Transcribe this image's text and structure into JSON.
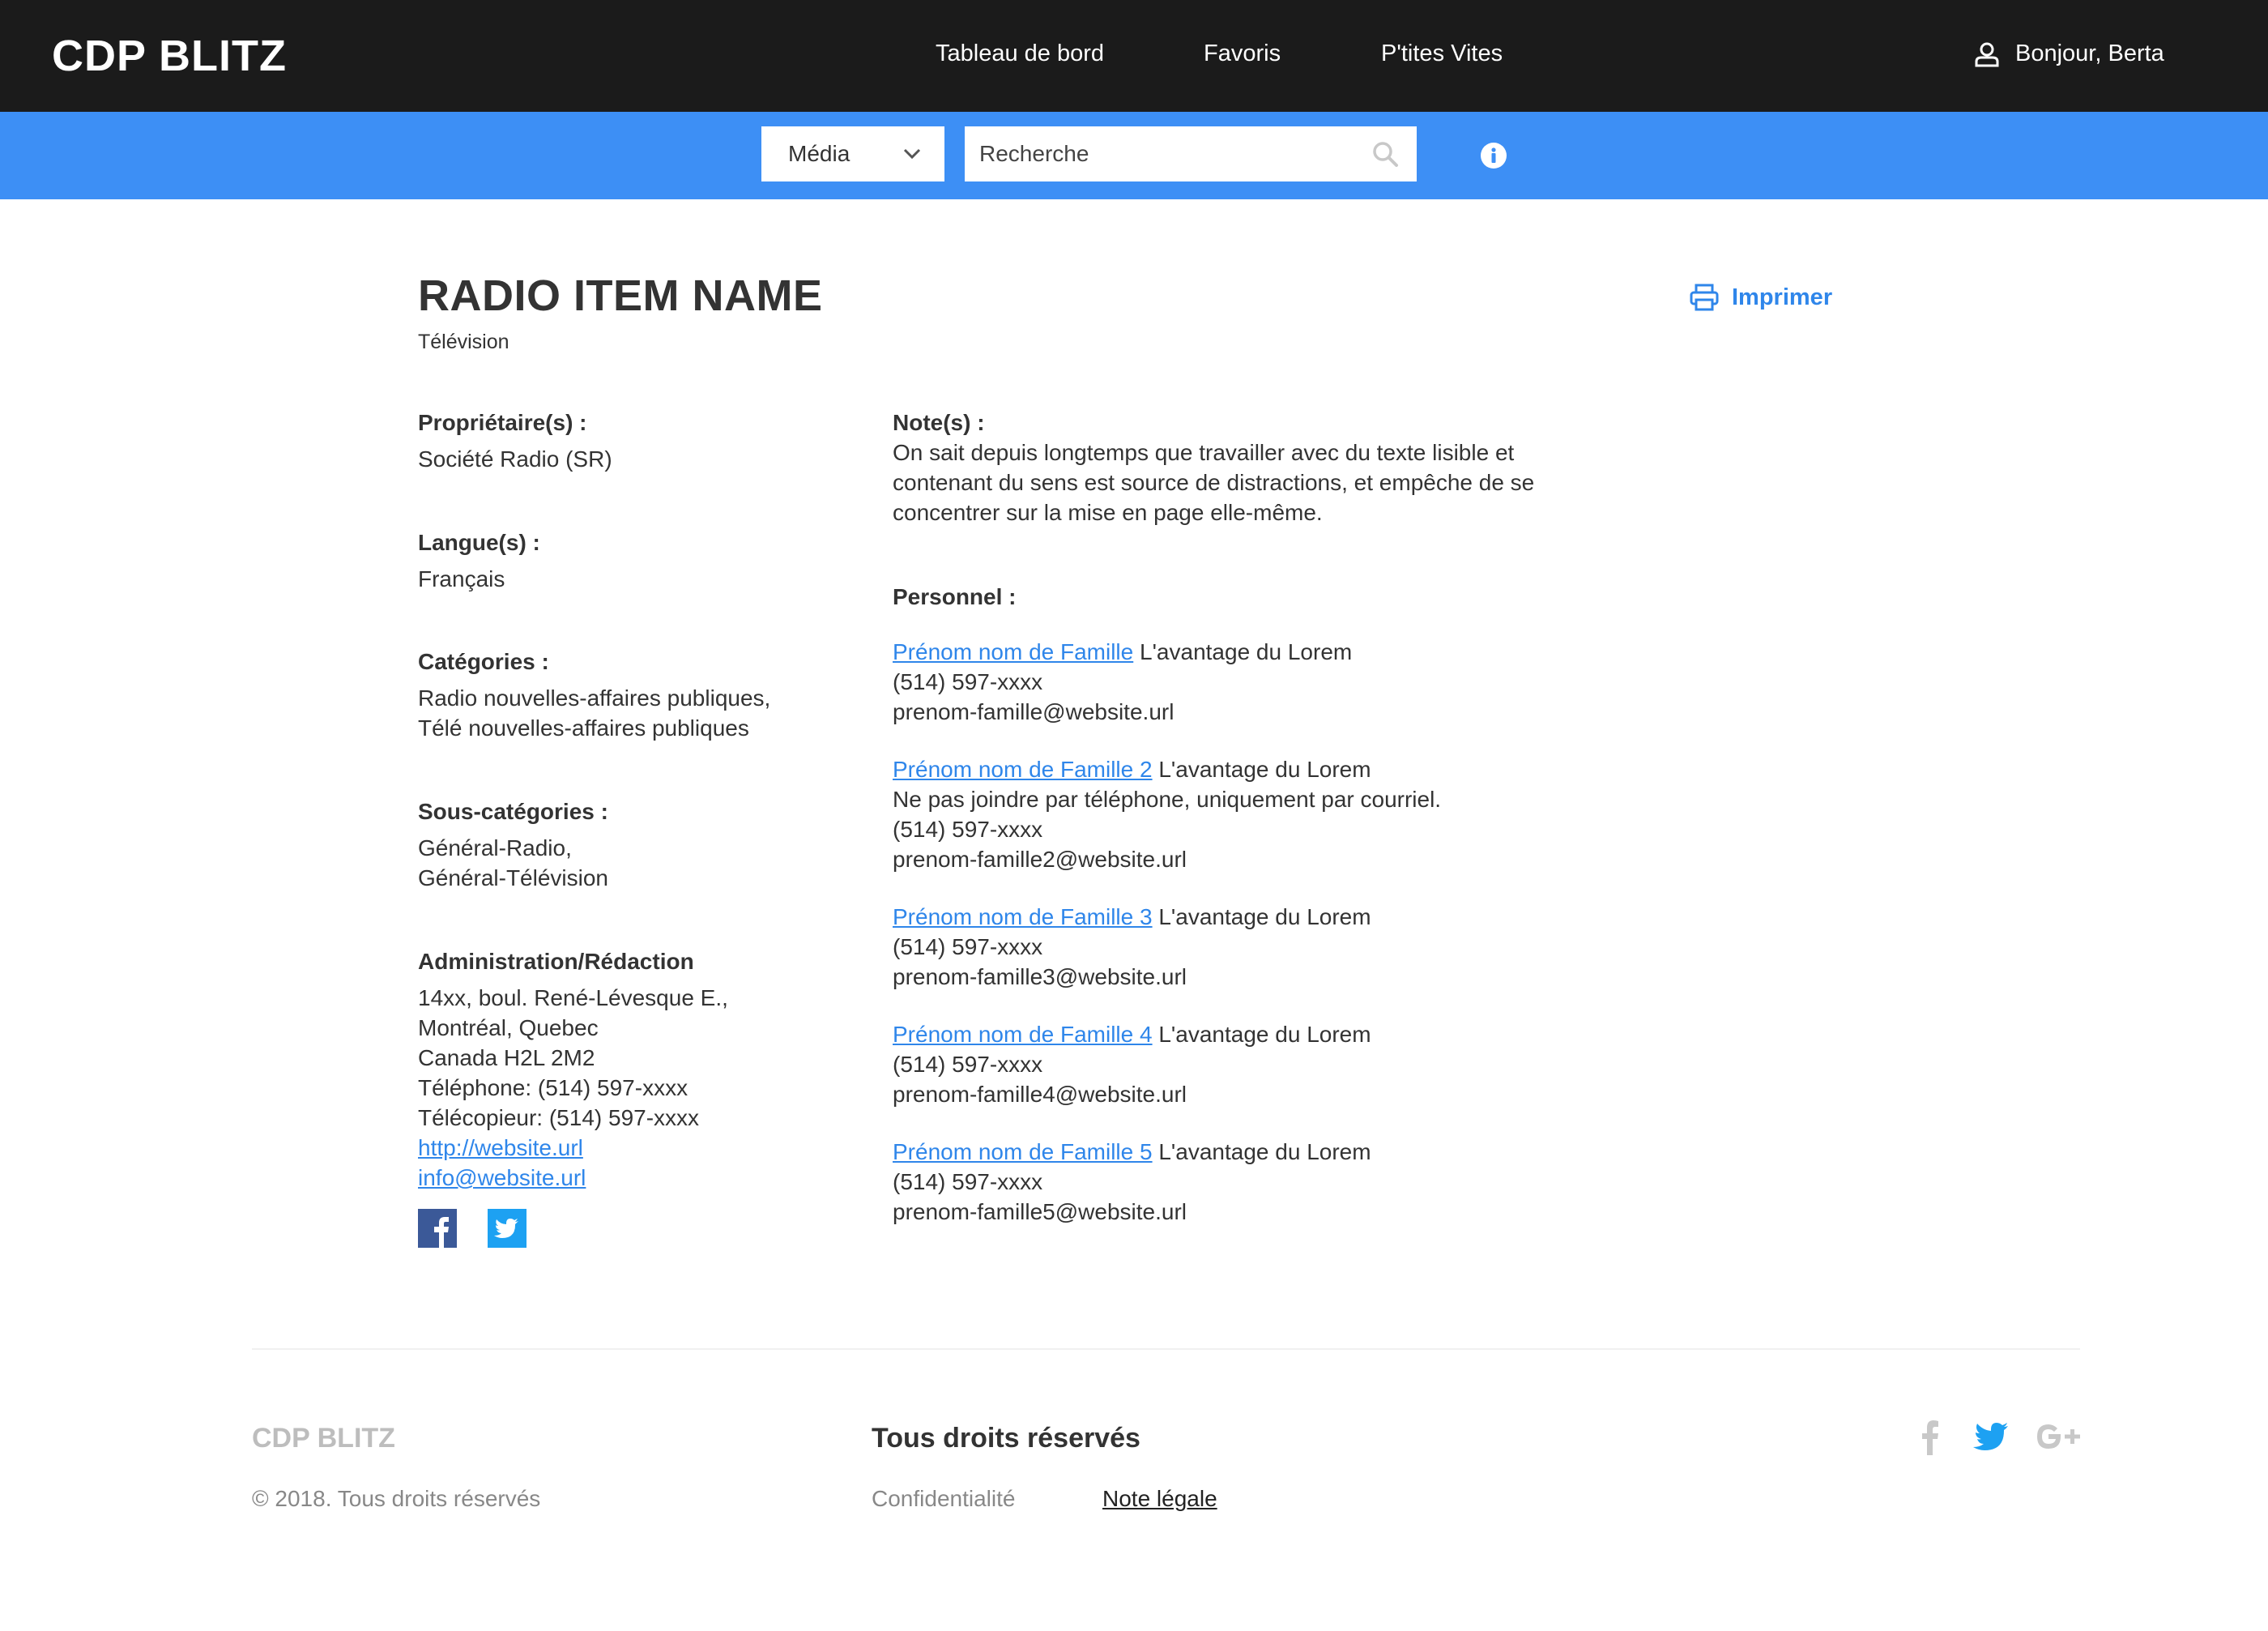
{
  "header": {
    "brand": "CDP BLITZ",
    "nav": [
      "Tableau de bord",
      "Favoris",
      "P'tites Vites"
    ],
    "greeting": "Bonjour, Berta"
  },
  "search": {
    "category": "Média",
    "placeholder": "Recherche"
  },
  "item": {
    "title": "RADIO ITEM NAME",
    "subtitle": "Télévision",
    "print_label": "Imprimer"
  },
  "details": {
    "owners_label": "Propriétaire(s) :",
    "owners_value": "Société Radio (SR)",
    "languages_label": "Langue(s) :",
    "languages_value": "Français",
    "categories_label": "Catégories :",
    "categories_lines": [
      "Radio nouvelles-affaires publiques,",
      "Télé nouvelles-affaires publiques"
    ],
    "subcategories_label": "Sous-catégories :",
    "subcategories_lines": [
      "Général-Radio,",
      "Général-Télévision"
    ],
    "admin_label": "Administration/Rédaction",
    "admin_lines": [
      "14xx, boul. René-Lévesque E.,",
      "Montréal, Quebec",
      "Canada H2L 2M2",
      "Téléphone: (514) 597-xxxx",
      "Télécopieur: (514) 597-xxxx"
    ],
    "website": "http://website.url",
    "email": "info@website.url"
  },
  "notes": {
    "label": "Note(s) :",
    "lines": [
      "On sait depuis longtemps que travailler avec du texte lisible et",
      "contenant du sens est source de distractions, et empêche de se",
      "concentrer sur la mise en page elle-même."
    ]
  },
  "personnel": {
    "label": "Personnel :",
    "people": [
      {
        "name": "Prénom nom de Famille",
        "role": "L'avantage du Lorem",
        "lines": [
          "(514) 597-xxxx",
          "prenom-famille@website.url"
        ]
      },
      {
        "name": "Prénom nom de Famille 2",
        "role": "L'avantage du Lorem",
        "lines": [
          "Ne pas joindre par téléphone, uniquement par courriel.",
          "(514) 597-xxxx",
          "prenom-famille2@website.url"
        ]
      },
      {
        "name": "Prénom nom de Famille 3",
        "role": "L'avantage du Lorem",
        "lines": [
          "(514) 597-xxxx",
          "prenom-famille3@website.url"
        ]
      },
      {
        "name": "Prénom nom de Famille 4",
        "role": "L'avantage du Lorem",
        "lines": [
          "(514) 597-xxxx",
          "prenom-famille4@website.url"
        ]
      },
      {
        "name": "Prénom nom de Famille 5",
        "role": "L'avantage du Lorem",
        "lines": [
          "(514) 597-xxxx",
          "prenom-famille5@website.url"
        ]
      }
    ]
  },
  "footer": {
    "brand": "CDP BLITZ",
    "copyright": "© 2018. Tous droits réservés",
    "title": "Tous droits réservés",
    "privacy": "Confidentialité",
    "legal": "Note légale"
  },
  "colors": {
    "topbar": "#1b1b1b",
    "searchbar": "#3d8ff5",
    "link": "#2f86ea",
    "facebook": "#3b5998",
    "twitter": "#1da1f2"
  }
}
